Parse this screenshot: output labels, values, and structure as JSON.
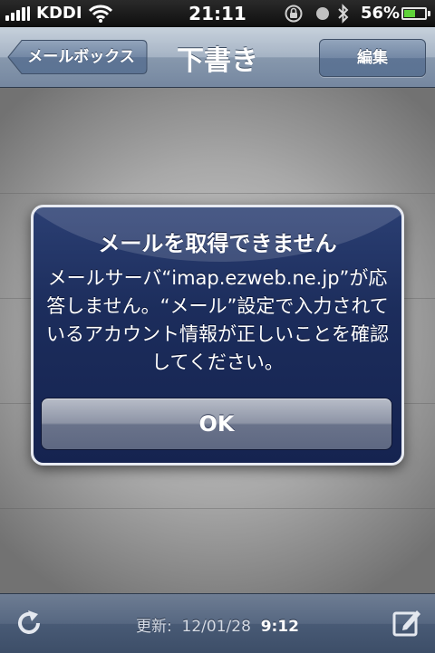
{
  "status_bar": {
    "carrier": "KDDI",
    "time": "21:11",
    "battery_percent": "56%",
    "battery_level": 0.56,
    "icons": [
      "signal-icon",
      "wifi-icon",
      "rotation-lock-icon",
      "alarm-icon",
      "bluetooth-icon",
      "battery-icon"
    ]
  },
  "nav": {
    "back_label": "メールボックス",
    "title": "下書き",
    "edit_label": "編集"
  },
  "alert": {
    "title": "メールを取得できません",
    "message": "メールサーバ“imap.ezweb.ne.jp”が応答しません。“メール”設定で入力されているアカウント情報が正しいことを確認してください。",
    "ok_label": "OK"
  },
  "toolbar": {
    "updated_label": "更新:",
    "updated_date": "12/01/28",
    "updated_time": "9:12",
    "icons": [
      "refresh-icon",
      "compose-icon"
    ]
  },
  "colors": {
    "alert_background": "#1c2d5c",
    "battery": "#5fd33a",
    "nav_bar": "#8798ad"
  }
}
